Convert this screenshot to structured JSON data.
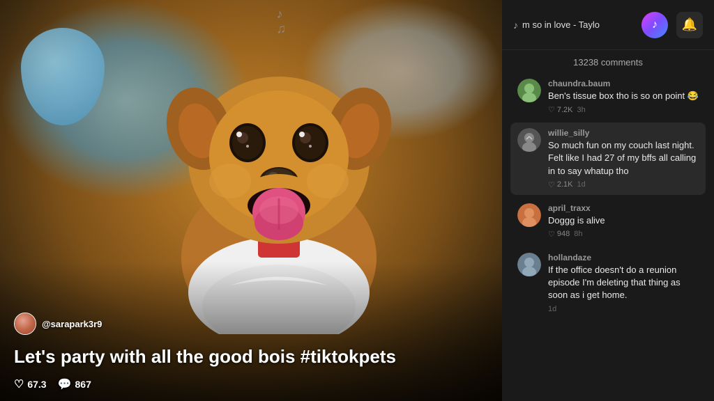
{
  "video": {
    "username": "@sarapark3r9",
    "caption": "Let's party with all the good bois #tiktokpets",
    "likes": "67.3",
    "comments": "867"
  },
  "header": {
    "song_text": "m so in love - Taylo",
    "music_notes": "♪♫"
  },
  "comments_panel": {
    "count_label": "13238 comments",
    "comments": [
      {
        "id": 1,
        "username": "chaundra.baum",
        "text": "Ben's tissue box tho is so on point 😂",
        "likes": "7.2K",
        "time": "3h",
        "highlighted": false,
        "avatar_color": "#5a8a4a"
      },
      {
        "id": 2,
        "username": "willie_silly",
        "text": "So much fun on my couch last night. Felt like I had 27 of my bffs all calling in to say whatup tho",
        "likes": "2.1K",
        "time": "1d",
        "highlighted": true,
        "avatar_color": "#888"
      },
      {
        "id": 3,
        "username": "april_traxx",
        "text": "Doggg is alive",
        "likes": "948",
        "time": "8h",
        "highlighted": false,
        "avatar_color": "#c87040"
      },
      {
        "id": 4,
        "username": "hollandaze",
        "text": "If the office doesn't do a reunion episode I'm deleting that thing as soon as i get home.",
        "likes": "",
        "time": "1d",
        "highlighted": false,
        "avatar_color": "#6a8090"
      }
    ]
  },
  "icons": {
    "heart": "♡",
    "comment": "💬",
    "bell": "🔔",
    "music_note": "♪"
  }
}
